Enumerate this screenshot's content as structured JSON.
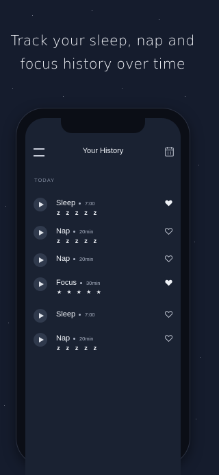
{
  "headline": "Track your sleep, nap and focus history over time",
  "headline_lines": [
    "Track your sleep, nap and",
    "focus history over time"
  ],
  "app": {
    "title": "Your History",
    "section_label": "TODAY",
    "icons": {
      "menu": "hamburger-menu-icon",
      "calendar": "calendar-icon",
      "play": "play-icon",
      "heart": "heart-icon"
    }
  },
  "entries": [
    {
      "name": "Sleep",
      "meta": "7:00",
      "rating": "z z z z z",
      "favorite": true
    },
    {
      "name": "Nap",
      "meta": "20min",
      "rating": "z z z z z",
      "favorite": false
    },
    {
      "name": "Nap",
      "meta": "20min",
      "rating": "",
      "favorite": false
    },
    {
      "name": "Focus",
      "meta": "30min",
      "rating": "★ ★ ★ ★ ★",
      "favorite": true
    },
    {
      "name": "Sleep",
      "meta": "7:00",
      "rating": "",
      "favorite": false
    },
    {
      "name": "Nap",
      "meta": "20min",
      "rating": "z z z z z",
      "favorite": false
    }
  ],
  "colors": {
    "background": "#151c2d",
    "screen": "#1a2232",
    "text": "#eef1f6",
    "muted": "#7f889b"
  }
}
